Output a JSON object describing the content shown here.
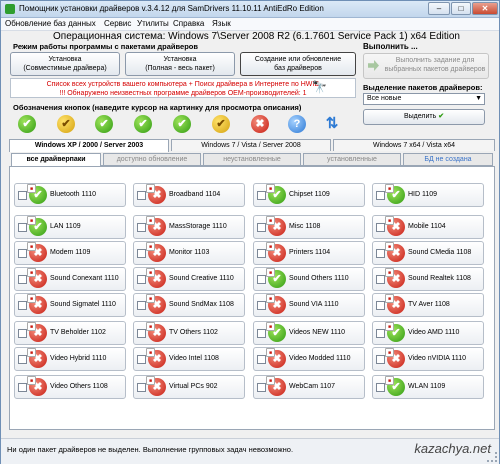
{
  "window": {
    "title": "Помощник установки драйверов v.3.4.12 для SamDrivers 11.10.11 AntiEdRo Edition",
    "minimize": "–",
    "maximize": "□",
    "close": "✕"
  },
  "menu": [
    "Обновление баз данных",
    "Сервис",
    "Утилиты",
    "Справка",
    "Язык"
  ],
  "os_info": "Операционная система: Windows 7\\Server 2008 R2  (6.1.7601 Service Pack 1) x64 Edition",
  "install_mode": {
    "label": "Режим работы программы с пакетами драйверов",
    "buttons": [
      {
        "line1": "Установка",
        "line2": "(Совместимые драйвера)"
      },
      {
        "line1": "Установка",
        "line2": "(Полная - весь пакет)"
      },
      {
        "line1": "Создание или обновление",
        "line2": "баз драйверов"
      }
    ]
  },
  "execute": {
    "label": "Выполнить ...",
    "task_line1": "Выполнить задание для",
    "task_line2": "выбранных пакетов драйверов"
  },
  "info": {
    "line1": "Список всех устройств вашего компьютера + Поиск драйвера в Интернете по HWID",
    "line2": "!!! Обнаружено неизвестных программе драйверов OEM-производителей: 1"
  },
  "selection": {
    "label": "Выделение пакетов драйверов:",
    "value": "Все новые",
    "button": "Выделить"
  },
  "legend_label": "Обозначения кнопок (наведите курсор на картинку для просмотра описания)",
  "legend_icons": [
    {
      "icon": "check-icon",
      "kind": "ok"
    },
    {
      "icon": "warning-check-icon",
      "kind": "warn"
    },
    {
      "icon": "new-check-icon",
      "kind": "ok"
    },
    {
      "icon": "update-check-icon",
      "kind": "ok"
    },
    {
      "icon": "partial-check-icon",
      "kind": "ok"
    },
    {
      "icon": "unknown-check-icon",
      "kind": "warn"
    },
    {
      "icon": "error-x-icon",
      "kind": "bad"
    },
    {
      "icon": "help-icon",
      "kind": "info"
    },
    {
      "icon": "refresh-arrows-icon",
      "kind": "refresh"
    }
  ],
  "os_tabs": [
    "Windows XP / 2000 / Server 2003",
    "Windows 7 / Vista / Server 2008",
    "Windows 7 x64 / Vista x64"
  ],
  "sub_tabs": [
    "все драйверпаки",
    "доступно обновление",
    "неустановленные",
    "установленные",
    "БД не создана"
  ],
  "drivers": [
    {
      "name": "Bluetooth 1110",
      "status": "ok"
    },
    {
      "name": "Broadband 1104",
      "status": "bad"
    },
    {
      "name": "Chipset 1109",
      "status": "ok"
    },
    {
      "name": "HID 1109",
      "status": "ok"
    },
    {
      "name": "LAN 1109",
      "status": "ok"
    },
    {
      "name": "MassStorage 1110",
      "status": "bad"
    },
    {
      "name": "Misc 1108",
      "status": "bad"
    },
    {
      "name": "Mobile 1104",
      "status": "bad"
    },
    {
      "name": "Modem 1109",
      "status": "bad"
    },
    {
      "name": "Monitor 1103",
      "status": "bad"
    },
    {
      "name": "Printers 1104",
      "status": "bad"
    },
    {
      "name": "Sound CMedia 1108",
      "status": "bad"
    },
    {
      "name": "Sound Conexant 1110",
      "status": "bad"
    },
    {
      "name": "Sound Creative 1110",
      "status": "bad"
    },
    {
      "name": "Sound Others 1110",
      "status": "ok"
    },
    {
      "name": "Sound Realtek 1108",
      "status": "bad"
    },
    {
      "name": "Sound Sigmatel 1110",
      "status": "bad"
    },
    {
      "name": "Sound SndMax 1108",
      "status": "bad"
    },
    {
      "name": "Sound VIA 1110",
      "status": "bad"
    },
    {
      "name": "TV Aver 1108",
      "status": "bad"
    },
    {
      "name": "TV Beholder 1102",
      "status": "bad"
    },
    {
      "name": "TV Others 1102",
      "status": "bad"
    },
    {
      "name": "Videos NEW 1110",
      "status": "ok"
    },
    {
      "name": "Video AMD 1110",
      "status": "ok"
    },
    {
      "name": "Video Hybrid 1110",
      "status": "bad"
    },
    {
      "name": "Video Intel 1108",
      "status": "bad"
    },
    {
      "name": "Video Modded 1110",
      "status": "bad"
    },
    {
      "name": "Video nVIDIA 1110",
      "status": "bad"
    },
    {
      "name": "Video Others 1108",
      "status": "bad"
    },
    {
      "name": "Virtual PCs 902",
      "status": "bad"
    },
    {
      "name": "WebCam 1107",
      "status": "bad"
    },
    {
      "name": "WLAN 1109",
      "status": "ok"
    }
  ],
  "status_bar": "Ни один пакет драйверов не выделен. Выполнение групповых задач невозможно.",
  "watermark": "kazachya.net",
  "colors": {
    "ok": "#2f9b12",
    "bad": "#c71c12",
    "warn": "#d4a10e",
    "info": "#2a77d4",
    "info_text": "#d40000"
  }
}
